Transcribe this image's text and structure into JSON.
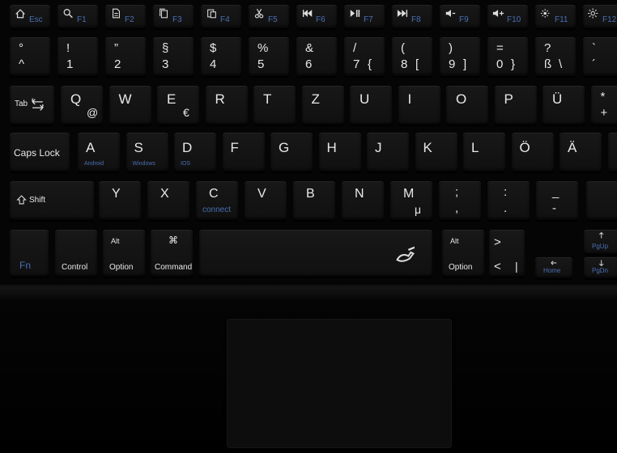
{
  "keyboard": {
    "function_row": [
      {
        "id": "esc",
        "main": "Esc",
        "icon": "home-icon",
        "main_color": "#4a6fb3"
      },
      {
        "id": "f1",
        "main": "F1",
        "icon": "search-icon",
        "main_color": "#4a6fb3"
      },
      {
        "id": "f2",
        "main": "F2",
        "icon": "document-icon",
        "main_color": "#4a6fb3"
      },
      {
        "id": "f3",
        "main": "F3",
        "icon": "copy-icon",
        "main_color": "#4a6fb3"
      },
      {
        "id": "f4",
        "main": "F4",
        "icon": "paste-icon",
        "main_color": "#4a6fb3"
      },
      {
        "id": "f5",
        "main": "F5",
        "icon": "scissors-icon",
        "main_color": "#4a6fb3"
      },
      {
        "id": "f6",
        "main": "F6",
        "icon": "previous-track-icon",
        "main_color": "#4a6fb3"
      },
      {
        "id": "f7",
        "main": "F7",
        "icon": "play-pause-icon",
        "main_color": "#4a6fb3"
      },
      {
        "id": "f8",
        "main": "F8",
        "icon": "next-track-icon",
        "main_color": "#4a6fb3"
      },
      {
        "id": "f9",
        "main": "F9",
        "icon": "volume-down-icon",
        "main_color": "#4a6fb3"
      },
      {
        "id": "f10",
        "main": "F10",
        "icon": "volume-up-icon",
        "main_color": "#4a6fb3"
      },
      {
        "id": "f11",
        "main": "F11",
        "icon": "brightness-down-icon",
        "main_color": "#4a6fb3"
      },
      {
        "id": "f12",
        "main": "F12",
        "icon": "brightness-up-icon",
        "main_color": "#4a6fb3"
      }
    ],
    "number_row": [
      {
        "id": "circumflex",
        "top": "°",
        "bottom": "^"
      },
      {
        "id": "1",
        "top": "!",
        "bottom": "1"
      },
      {
        "id": "2",
        "top": "”",
        "bottom": "2"
      },
      {
        "id": "3",
        "top": "§",
        "bottom": "3"
      },
      {
        "id": "4",
        "top": "$",
        "bottom": "4"
      },
      {
        "id": "5",
        "top": "%",
        "bottom": "5"
      },
      {
        "id": "6",
        "top": "&",
        "bottom": "6"
      },
      {
        "id": "7",
        "top": "/",
        "bottom": "7",
        "alt": "{"
      },
      {
        "id": "8",
        "top": "(",
        "bottom": "8",
        "alt": "["
      },
      {
        "id": "9",
        "top": ")",
        "bottom": "9",
        "alt": "]"
      },
      {
        "id": "0",
        "top": "=",
        "bottom": "0",
        "alt": "}"
      },
      {
        "id": "sz",
        "top": "?",
        "bottom": "ß",
        "alt": "\\"
      },
      {
        "id": "accent",
        "top": "`",
        "bottom": "´"
      }
    ],
    "qwerty_row": [
      {
        "id": "tab",
        "main": "Tab",
        "icon": "tab-arrows-icon"
      },
      {
        "id": "q",
        "main": "Q",
        "alt": "@"
      },
      {
        "id": "w",
        "main": "W"
      },
      {
        "id": "e",
        "main": "E",
        "alt": "€"
      },
      {
        "id": "r",
        "main": "R"
      },
      {
        "id": "t",
        "main": "T"
      },
      {
        "id": "z",
        "main": "Z"
      },
      {
        "id": "u",
        "main": "U"
      },
      {
        "id": "i",
        "main": "I"
      },
      {
        "id": "o",
        "main": "O"
      },
      {
        "id": "p",
        "main": "P"
      },
      {
        "id": "ue",
        "main": "Ü"
      },
      {
        "id": "plus",
        "top": "*",
        "bottom": "+"
      }
    ],
    "home_row": [
      {
        "id": "capslock",
        "main": "Caps Lock"
      },
      {
        "id": "a",
        "main": "A",
        "sub": "Android"
      },
      {
        "id": "s",
        "main": "S",
        "sub": "Windows"
      },
      {
        "id": "d",
        "main": "D",
        "sub": "IOS"
      },
      {
        "id": "f",
        "main": "F"
      },
      {
        "id": "g",
        "main": "G"
      },
      {
        "id": "h",
        "main": "H"
      },
      {
        "id": "j",
        "main": "J"
      },
      {
        "id": "k",
        "main": "K"
      },
      {
        "id": "l",
        "main": "L"
      },
      {
        "id": "oe",
        "main": "Ö"
      },
      {
        "id": "ae",
        "main": "Ä"
      },
      {
        "id": "hash",
        "main": ""
      }
    ],
    "shift_row": [
      {
        "id": "shift",
        "main": "Shift",
        "icon": "shift-arrow-icon"
      },
      {
        "id": "y",
        "main": "Y"
      },
      {
        "id": "x",
        "main": "X"
      },
      {
        "id": "c",
        "main": "C",
        "sub": "connect"
      },
      {
        "id": "v",
        "main": "V"
      },
      {
        "id": "b",
        "main": "B"
      },
      {
        "id": "n",
        "main": "N"
      },
      {
        "id": "m",
        "main": "M",
        "alt": "μ"
      },
      {
        "id": "comma",
        "top": ";",
        "bottom": ","
      },
      {
        "id": "period",
        "top": ":",
        "bottom": "."
      },
      {
        "id": "minus",
        "top": "_",
        "bottom": "-"
      },
      {
        "id": "rshift",
        "main": ""
      }
    ],
    "bottom_row": [
      {
        "id": "fn",
        "main": "Fn"
      },
      {
        "id": "control",
        "main": "Control"
      },
      {
        "id": "option",
        "top": "Alt",
        "main": "Option"
      },
      {
        "id": "command",
        "top": "⌘",
        "main": "Command"
      },
      {
        "id": "space",
        "main": "",
        "icon": "pen-hand-icon"
      },
      {
        "id": "roption",
        "top": "Alt",
        "main": "Option"
      },
      {
        "id": "angle",
        "top": ">",
        "bottom": "<",
        "alt": "|"
      },
      {
        "id": "home",
        "main": "Home",
        "icon": "arrow-left-icon"
      },
      {
        "id": "pgup",
        "main": "PgUp",
        "icon": "arrow-up-icon"
      },
      {
        "id": "pgdn",
        "main": "PgDn",
        "icon": "arrow-down-icon"
      }
    ]
  },
  "touchpad": {
    "present": true
  },
  "colors": {
    "accent_blue": "#4a6fb3",
    "key_label": "#e8e8e8",
    "key_face": "#141414",
    "background": "#000000"
  }
}
